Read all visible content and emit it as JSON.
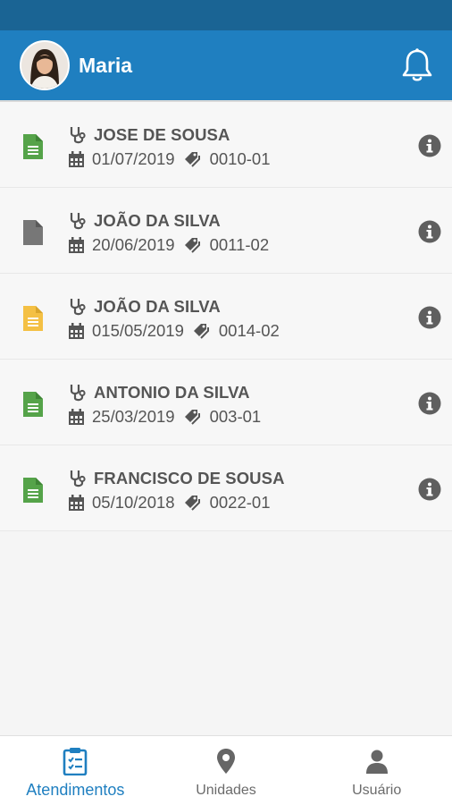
{
  "header": {
    "user_name": "Maria"
  },
  "colors": {
    "primary": "#1f7fc0",
    "status_bar": "#1a6494",
    "doc_green": "#55a349",
    "doc_gray": "#777777",
    "doc_yellow": "#f4c044"
  },
  "appointments": [
    {
      "patient": "JOSE DE SOUSA",
      "date": "01/07/2019",
      "code": "0010-01",
      "status_icon": "document-green-icon"
    },
    {
      "patient": "JOÃO DA SILVA",
      "date": "20/06/2019",
      "code": "0011-02",
      "status_icon": "document-gray-icon"
    },
    {
      "patient": "JOÃO DA SILVA",
      "date": "015/05/2019",
      "code": "0014-02",
      "status_icon": "document-yellow-icon"
    },
    {
      "patient": "ANTONIO DA SILVA",
      "date": "25/03/2019",
      "code": "003-01",
      "status_icon": "document-green-icon"
    },
    {
      "patient": "FRANCISCO DE SOUSA",
      "date": "05/10/2018",
      "code": "0022-01",
      "status_icon": "document-green-icon"
    }
  ],
  "bottom_nav": [
    {
      "label": "Atendimentos",
      "icon": "clipboard-list-icon",
      "active": true
    },
    {
      "label": "Unidades",
      "icon": "map-pin-icon",
      "active": false
    },
    {
      "label": "Usuário",
      "icon": "user-icon",
      "active": false
    }
  ]
}
